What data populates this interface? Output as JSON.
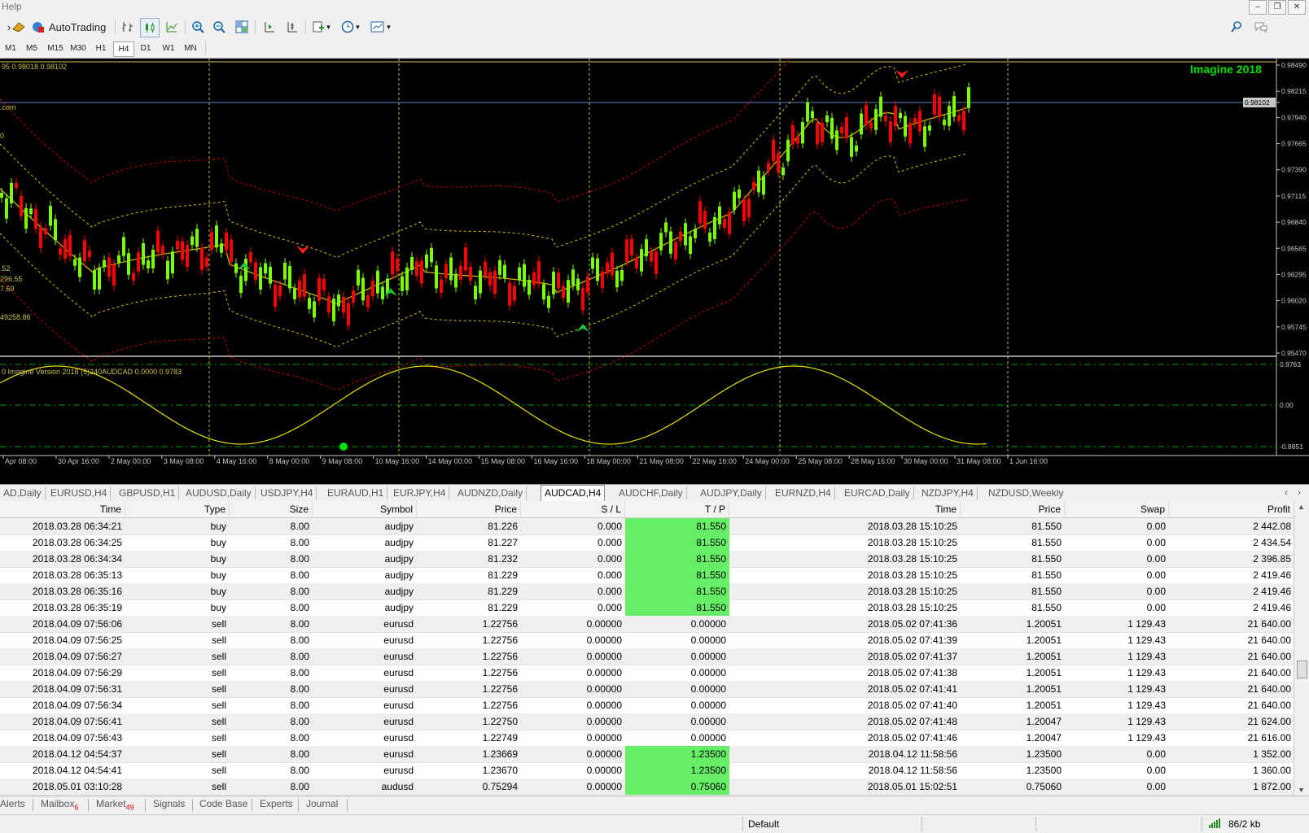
{
  "menu": {
    "help": "Help"
  },
  "toolbar": {
    "autotrading": "AutoTrading"
  },
  "periods": [
    "M1",
    "M5",
    "M15",
    "M30",
    "H1",
    "H4",
    "D1",
    "W1",
    "MN"
  ],
  "active_period": "H4",
  "chart": {
    "brand": "Imagine 2018",
    "info_line": "95 0.98018 0.98102",
    "left_labels": [
      ".com",
      "0",
      ".52",
      "296.55",
      "7.69",
      "49258.86"
    ],
    "indicator_label": "0 Imagine Version 2018 (5)240AUDCAD 0.0000 0.9783",
    "price_ticks": [
      "0.98490",
      "0.98215",
      "0.98102",
      "0.97940",
      "0.97665",
      "0.97390",
      "0.97115",
      "0.96840",
      "0.96565",
      "0.96295",
      "0.96020",
      "0.95745",
      "0.95470"
    ],
    "current_price": "0.98102",
    "ind_ticks": [
      "0.9763",
      "0.00",
      "-0.8851"
    ],
    "time_labels": [
      "Apr 08:00",
      "30 Apr 16:00",
      "2 May 00:00",
      "3 May 08:00",
      "4 May 16:00",
      "8 May 00:00",
      "9 May 08:00",
      "10 May 16:00",
      "14 May 00:00",
      "15 May 08:00",
      "16 May 16:00",
      "18 May 00:00",
      "21 May 08:00",
      "22 May 16:00",
      "24 May 00:00",
      "25 May 08:00",
      "28 May 16:00",
      "30 May 00:00",
      "31 May 08:00",
      "1 Jun 16:00"
    ],
    "colors": {
      "bg": "#000000",
      "bull": "#7cfc00",
      "bear": "#ff0000",
      "ma": "#d4c000",
      "band_outer": "#cc0000",
      "brand": "#00e000",
      "grid": "#c8c050"
    }
  },
  "symbol_tabs": [
    "AD,Daily",
    "EURUSD,H4",
    "GBPUSD,H1",
    "AUDUSD,Daily",
    "USDJPY,H4",
    "EURAUD,H1",
    "EURJPY,H4",
    "AUDNZD,Daily",
    "AUDCAD,H4",
    "AUDCHF,Daily",
    "AUDJPY,Daily",
    "EURNZD,H4",
    "EURCAD,Daily",
    "NZDJPY,H4",
    "NZDUSD,Weekly"
  ],
  "active_symbol_tab": "AUDCAD,H4",
  "table": {
    "columns": [
      "Time",
      "Type",
      "Size",
      "Symbol",
      "Price",
      "S / L",
      "T / P",
      "Time",
      "Price",
      "Swap",
      "Profit"
    ],
    "rows": [
      [
        "2018.03.28 06:34:21",
        "buy",
        "8.00",
        "audjpy",
        "81.226",
        "0.000",
        "81.550",
        "2018.03.28 15:10:25",
        "81.550",
        "0.00",
        "2 442.08"
      ],
      [
        "2018.03.28 06:34:25",
        "buy",
        "8.00",
        "audjpy",
        "81.227",
        "0.000",
        "81.550",
        "2018.03.28 15:10:25",
        "81.550",
        "0.00",
        "2 434.54"
      ],
      [
        "2018.03.28 06:34:34",
        "buy",
        "8.00",
        "audjpy",
        "81.232",
        "0.000",
        "81.550",
        "2018.03.28 15:10:25",
        "81.550",
        "0.00",
        "2 396.85"
      ],
      [
        "2018.03.28 06:35:13",
        "buy",
        "8.00",
        "audjpy",
        "81.229",
        "0.000",
        "81.550",
        "2018.03.28 15:10:25",
        "81.550",
        "0.00",
        "2 419.46"
      ],
      [
        "2018.03.28 06:35:16",
        "buy",
        "8.00",
        "audjpy",
        "81.229",
        "0.000",
        "81.550",
        "2018.03.28 15:10:25",
        "81.550",
        "0.00",
        "2 419.46"
      ],
      [
        "2018.03.28 06:35:19",
        "buy",
        "8.00",
        "audjpy",
        "81.229",
        "0.000",
        "81.550",
        "2018.03.28 15:10:25",
        "81.550",
        "0.00",
        "2 419.46"
      ],
      [
        "2018.04.09 07:56:06",
        "sell",
        "8.00",
        "eurusd",
        "1.22756",
        "0.00000",
        "0.00000",
        "2018.05.02 07:41:36",
        "1.20051",
        "1 129.43",
        "21 640.00"
      ],
      [
        "2018.04.09 07:56:25",
        "sell",
        "8.00",
        "eurusd",
        "1.22756",
        "0.00000",
        "0.00000",
        "2018.05.02 07:41:39",
        "1.20051",
        "1 129.43",
        "21 640.00"
      ],
      [
        "2018.04.09 07:56:27",
        "sell",
        "8.00",
        "eurusd",
        "1.22756",
        "0.00000",
        "0.00000",
        "2018.05.02 07:41:37",
        "1.20051",
        "1 129.43",
        "21 640.00"
      ],
      [
        "2018.04.09 07:56:29",
        "sell",
        "8.00",
        "eurusd",
        "1.22756",
        "0.00000",
        "0.00000",
        "2018.05.02 07:41:38",
        "1.20051",
        "1 129.43",
        "21 640.00"
      ],
      [
        "2018.04.09 07:56:31",
        "sell",
        "8.00",
        "eurusd",
        "1.22756",
        "0.00000",
        "0.00000",
        "2018.05.02 07:41:41",
        "1.20051",
        "1 129.43",
        "21 640.00"
      ],
      [
        "2018.04.09 07:56:34",
        "sell",
        "8.00",
        "eurusd",
        "1.22756",
        "0.00000",
        "0.00000",
        "2018.05.02 07:41:40",
        "1.20051",
        "1 129.43",
        "21 640.00"
      ],
      [
        "2018.04.09 07:56:41",
        "sell",
        "8.00",
        "eurusd",
        "1.22750",
        "0.00000",
        "0.00000",
        "2018.05.02 07:41:48",
        "1.20047",
        "1 129.43",
        "21 624.00"
      ],
      [
        "2018.04.09 07:56:43",
        "sell",
        "8.00",
        "eurusd",
        "1.22749",
        "0.00000",
        "0.00000",
        "2018.05.02 07:41:46",
        "1.20047",
        "1 129.43",
        "21 616.00"
      ],
      [
        "2018.04.12 04:54:37",
        "sell",
        "8.00",
        "eurusd",
        "1.23669",
        "0.00000",
        "1.23500",
        "2018.04.12 11:58:56",
        "1.23500",
        "0.00",
        "1 352.00"
      ],
      [
        "2018.04.12 04:54:41",
        "sell",
        "8.00",
        "eurusd",
        "1.23670",
        "0.00000",
        "1.23500",
        "2018.04.12 11:58:56",
        "1.23500",
        "0.00",
        "1 360.00"
      ],
      [
        "2018.05.01 03:10:28",
        "sell",
        "8.00",
        "audusd",
        "0.75294",
        "0.00000",
        "0.75060",
        "2018.05.01 15:02:51",
        "0.75060",
        "0.00",
        "1 872.00"
      ]
    ]
  },
  "bottom_tabs": [
    {
      "label": "Alerts",
      "badge": ""
    },
    {
      "label": "Mailbox",
      "badge": "6"
    },
    {
      "label": "Market",
      "badge": "49"
    },
    {
      "label": "Signals",
      "badge": ""
    },
    {
      "label": "Code Base",
      "badge": ""
    },
    {
      "label": "Experts",
      "badge": ""
    },
    {
      "label": "Journal",
      "badge": ""
    }
  ],
  "status": {
    "profile": "Default",
    "traffic": "86/2 kb"
  }
}
